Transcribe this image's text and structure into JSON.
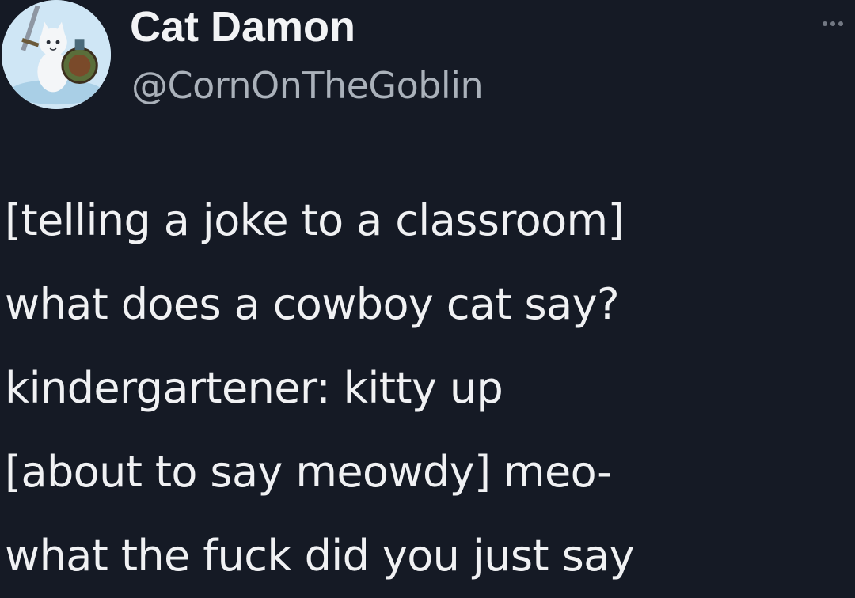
{
  "author": {
    "display_name": "Cat Damon",
    "handle": "@CornOnTheGoblin",
    "avatar_icon": "cat-knight-avatar"
  },
  "menu": {
    "icon": "more-options-icon"
  },
  "tweet": {
    "lines": [
      "[telling a joke to a classroom]",
      "what does a cowboy cat say?",
      "kindergartener: kitty up",
      "[about to say meowdy] meo-",
      "what the fuck did you just say"
    ]
  },
  "colors": {
    "background": "#151a25",
    "text": "#f0f1f3",
    "secondary_text": "#aab1ba"
  }
}
